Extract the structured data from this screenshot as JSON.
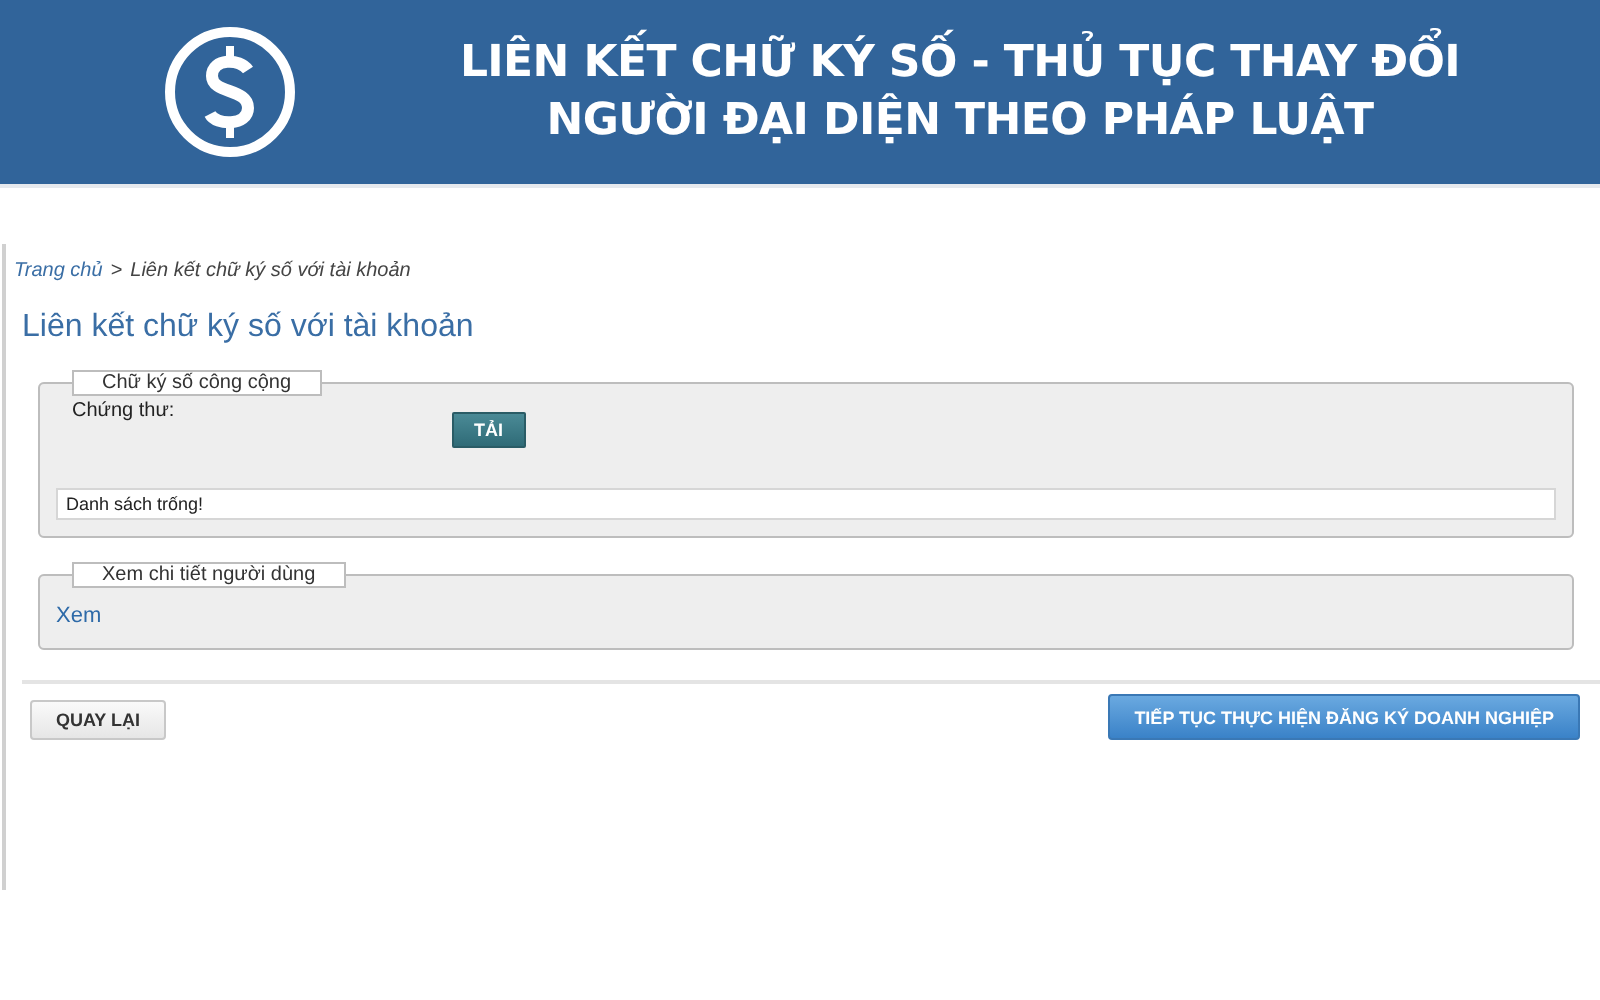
{
  "banner": {
    "title_lines": [
      "LIÊN KẾT CHỮ KÝ SỐ - THỦ TỤC THAY ĐỔI",
      "NGƯỜI ĐẠI DIỆN THEO PHÁP LUẬT"
    ]
  },
  "breadcrumb": [
    "Trang chủ",
    ">",
    "Liên kết chữ ký số với tài khoản"
  ],
  "heading": "Liên kết chữ ký số với tài khoản",
  "certificate_panel": {
    "legend": "Chữ ký số công cộng",
    "label": "Chứng thư:",
    "button": "TẢI",
    "list_message": "Danh sách trống!"
  },
  "user_panel": {
    "legend": "Xem chi tiết người dùng",
    "link": "Xem"
  },
  "buttons": [
    {
      "label": "QUAY LẠI",
      "kind": "secondary"
    },
    {
      "label": "TIẾP TỤC THỰC HIỆN ĐĂNG KÝ DOANH NGHIỆP",
      "kind": "primary"
    }
  ]
}
